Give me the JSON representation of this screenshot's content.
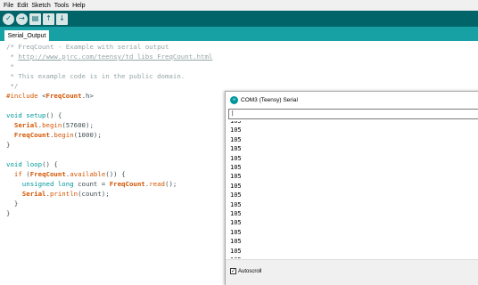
{
  "menu": [
    "File",
    "Edit",
    "Sketch",
    "Tools",
    "Help"
  ],
  "toolbar": {
    "buttons": [
      {
        "name": "verify",
        "glyph": "✓"
      },
      {
        "name": "upload",
        "glyph": "→"
      },
      {
        "name": "new",
        "glyph": "▤"
      },
      {
        "name": "open",
        "glyph": "↑"
      },
      {
        "name": "save",
        "glyph": "↓"
      }
    ]
  },
  "tab": {
    "label": "Serial_Output"
  },
  "code": {
    "line1": "/* FreqCount - Example with serial output",
    "line2_prefix": " * ",
    "line2_link": "http://www.pjrc.com/teensy/td_libs_FreqCount.html",
    "line3": " *",
    "line4": " * This example code is in the public domain.",
    "line5": " */",
    "include_kw": "#include",
    "include_sp": " ",
    "include_lt": "<",
    "include_lib": "FreqCount",
    "include_gt": ".h>",
    "setup_type": "void",
    "setup_fn": " setup",
    "setup_rest": "() {",
    "serial_obj": "  Serial",
    "serial_dot": ".",
    "serial_begin": "begin",
    "serial_args": "(57600);",
    "fc_obj": "  FreqCount",
    "fc_dot": ".",
    "fc_begin": "begin",
    "fc_args": "(1000);",
    "close1": "}",
    "loop_type": "void",
    "loop_fn": " loop",
    "loop_rest": "() {",
    "if_kw": "  if",
    "if_open": " (",
    "if_obj": "FreqCount",
    "if_dot": ".",
    "if_fn": "available",
    "if_close": "()) {",
    "decl_type": "    unsigned long",
    "decl_mid": " count = ",
    "decl_obj": "FreqCount",
    "decl_dot": ".",
    "decl_fn": "read",
    "decl_end": "();",
    "print_obj": "    Serial",
    "print_dot": ".",
    "print_fn": "println",
    "print_args": "(count);",
    "close2": "  }",
    "close3": "}"
  },
  "serial_monitor": {
    "title": "COM3 (Teensy) Serial",
    "icon": "∞",
    "input_value": "|",
    "output_lines": [
      "105",
      "105",
      "105",
      "105",
      "105",
      "105",
      "105",
      "105",
      "105",
      "105",
      "105",
      "105",
      "105",
      "105",
      "105",
      "105"
    ],
    "autoscroll_label": "Autoscroll",
    "autoscroll_checked": "✓"
  }
}
